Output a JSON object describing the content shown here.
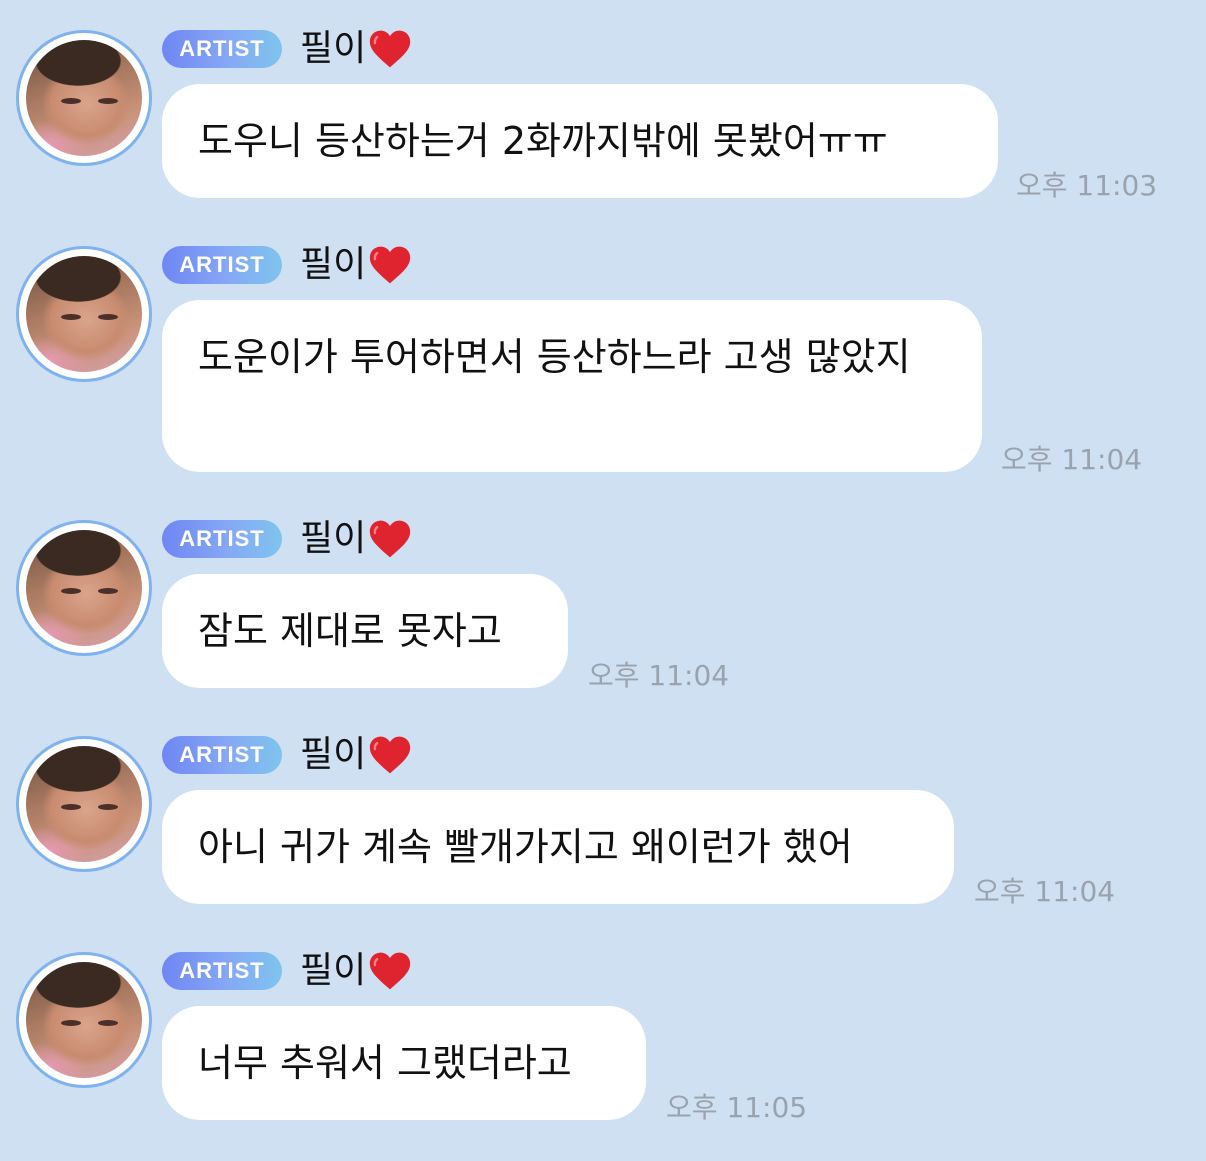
{
  "messages": [
    {
      "badge": "ARTIST",
      "name": "필이",
      "name_emoji": "heart-icon",
      "text": "도우니 등산하는거 2화까지밖에 못봤어ㅠㅠ",
      "time": "오후 11:03"
    },
    {
      "badge": "ARTIST",
      "name": "필이",
      "name_emoji": "heart-icon",
      "text": "도운이가 투어하면서 등산하느라 고생 많았지",
      "time": "오후 11:04"
    },
    {
      "badge": "ARTIST",
      "name": "필이",
      "name_emoji": "heart-icon",
      "text": "잠도 제대로 못자고",
      "time": "오후 11:04"
    },
    {
      "badge": "ARTIST",
      "name": "필이",
      "name_emoji": "heart-icon",
      "text": "아니 귀가 계속 빨개가지고 왜이런가 했어",
      "time": "오후 11:04"
    },
    {
      "badge": "ARTIST",
      "name": "필이",
      "name_emoji": "heart-icon",
      "text": "너무 추워서 그랬더라고",
      "time": "오후 11:05"
    }
  ],
  "colors": {
    "background": "#cfe0f3",
    "bubble": "#ffffff",
    "badge_gradient_start": "#6f86f4",
    "badge_gradient_end": "#7ec4ee",
    "avatar_ring": "#7fb2ee",
    "time_text": "#9aa3ad",
    "heart": "#e0242f"
  }
}
